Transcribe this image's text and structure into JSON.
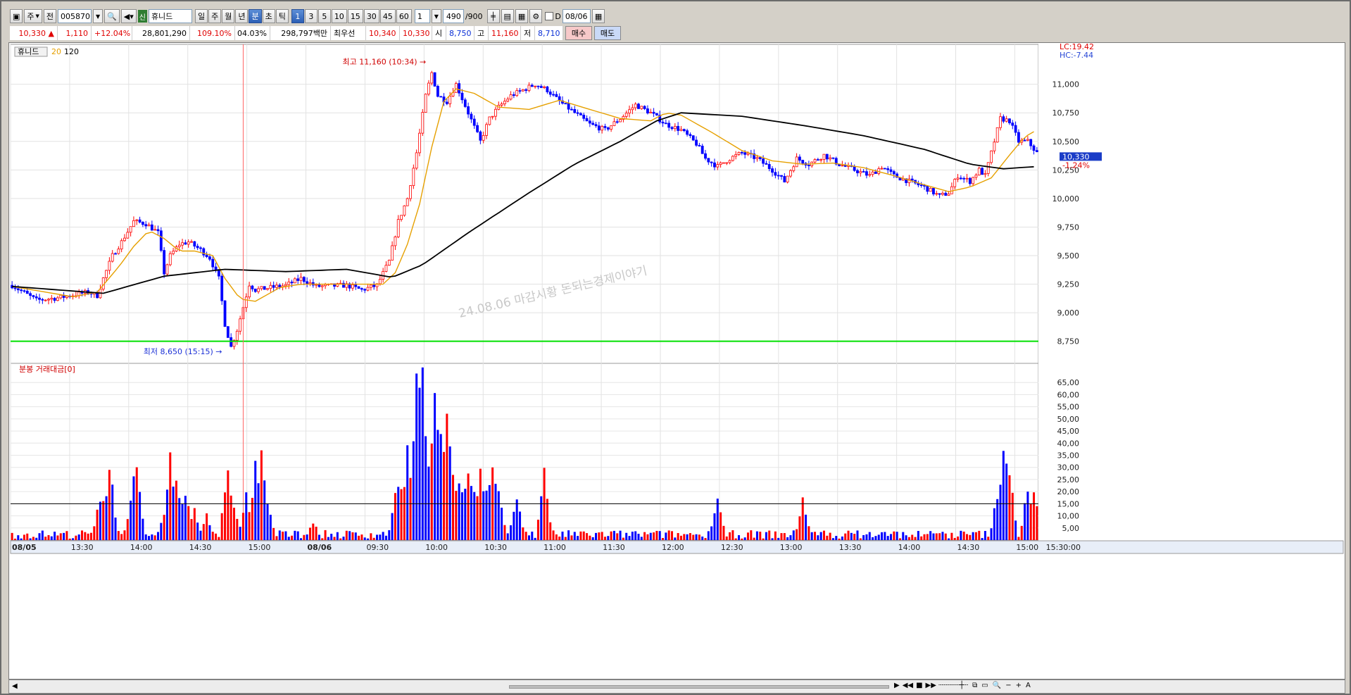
{
  "toolbar": {
    "market_label": "주",
    "period_label": "전",
    "code": "005870",
    "badge": "신",
    "name": "휴니드",
    "periods": [
      "일",
      "주",
      "월",
      "년",
      "분",
      "초",
      "틱"
    ],
    "active_period": "분",
    "intervals": [
      "1",
      "3",
      "5",
      "10",
      "15",
      "30",
      "45",
      "60"
    ],
    "active_interval": "1",
    "custom_interval": "1",
    "count": "490",
    "count_max": "/900",
    "d_label": "D",
    "date": "08/06"
  },
  "quote": {
    "price": "10,330",
    "change": "1,110",
    "change_pct": "+12.04%",
    "volume": "28,801,290",
    "vol_ratio": "109.10%",
    "turnover": "04.03%",
    "amount": "298,797백만",
    "label_recent": "최우선",
    "ask": "10,340",
    "bid": "10,330",
    "open_label": "시",
    "open": "8,750",
    "high_label": "고",
    "high": "11,160",
    "low_label": "저",
    "low": "8,710",
    "buy": "매수",
    "sell": "매도"
  },
  "colors": {
    "up": "#ff0000",
    "down": "#0000ff",
    "ma20": "#e6a000",
    "ma120": "#000000",
    "support": "#00e000",
    "cursor": "#ff6666"
  },
  "chart_data": [
    {
      "type": "candlestick",
      "title": "휴니드",
      "legend": [
        "20",
        "120"
      ],
      "ylim": [
        8600,
        11300
      ],
      "yticks": [
        "11,000",
        "10,750",
        "10,500",
        "10,250",
        "10,000",
        "9,750",
        "9,500",
        "9,250",
        "9,000",
        "8,750"
      ],
      "ytick_values": [
        11000,
        10750,
        10500,
        10250,
        10000,
        9750,
        9500,
        9250,
        9000,
        8750
      ],
      "x_labels": [
        "08/05",
        "13:30",
        "14:00",
        "14:30",
        "15:00",
        "08/06",
        "09:30",
        "10:00",
        "10:30",
        "11:00",
        "11:30",
        "12:00",
        "12:30",
        "13:00",
        "13:30",
        "14:00",
        "14:30",
        "15:00",
        "15:30:00"
      ],
      "lc_label": "LC:19.42",
      "hc_label": "HC:-7.44",
      "last_price": "10,330",
      "last_change": "-1.24%",
      "high_note": "최고 11,160 (10:34)",
      "low_note": "최저 8,650 (15:15)",
      "support_level": 8750,
      "watermark": "24.08.06 마감시황   돈되는경제이야기",
      "price_path": [
        [
          0,
          9240
        ],
        [
          8,
          9110
        ],
        [
          15,
          9130
        ],
        [
          25,
          9180
        ],
        [
          28,
          9150
        ],
        [
          30,
          9300
        ],
        [
          33,
          9500
        ],
        [
          36,
          9620
        ],
        [
          40,
          9800
        ],
        [
          44,
          9780
        ],
        [
          48,
          9700
        ],
        [
          50,
          9350
        ],
        [
          52,
          9500
        ],
        [
          55,
          9600
        ],
        [
          58,
          9620
        ],
        [
          62,
          9550
        ],
        [
          65,
          9480
        ],
        [
          68,
          9300
        ],
        [
          70,
          8900
        ],
        [
          72,
          8700
        ],
        [
          74,
          8850
        ],
        [
          76,
          9050
        ],
        [
          78,
          9250
        ],
        [
          80,
          9200
        ],
        [
          85,
          9220
        ],
        [
          90,
          9240
        ],
        [
          95,
          9300
        ],
        [
          100,
          9230
        ],
        [
          110,
          9240
        ],
        [
          115,
          9200
        ],
        [
          120,
          9240
        ],
        [
          124,
          9450
        ],
        [
          127,
          9800
        ],
        [
          130,
          10000
        ],
        [
          133,
          10400
        ],
        [
          136,
          10900
        ],
        [
          138,
          11100
        ],
        [
          140,
          10900
        ],
        [
          143,
          10850
        ],
        [
          146,
          11000
        ],
        [
          150,
          10750
        ],
        [
          154,
          10500
        ],
        [
          157,
          10700
        ],
        [
          160,
          10800
        ],
        [
          164,
          10900
        ],
        [
          168,
          10950
        ],
        [
          172,
          11000
        ],
        [
          176,
          10950
        ],
        [
          180,
          10850
        ],
        [
          185,
          10750
        ],
        [
          190,
          10650
        ],
        [
          195,
          10600
        ],
        [
          200,
          10700
        ],
        [
          205,
          10820
        ],
        [
          210,
          10750
        ],
        [
          215,
          10650
        ],
        [
          220,
          10600
        ],
        [
          225,
          10480
        ],
        [
          228,
          10350
        ],
        [
          232,
          10280
        ],
        [
          236,
          10350
        ],
        [
          240,
          10400
        ],
        [
          245,
          10350
        ],
        [
          250,
          10250
        ],
        [
          254,
          10150
        ],
        [
          258,
          10350
        ],
        [
          262,
          10300
        ],
        [
          267,
          10380
        ],
        [
          272,
          10300
        ],
        [
          277,
          10250
        ],
        [
          282,
          10200
        ],
        [
          286,
          10280
        ],
        [
          290,
          10200
        ],
        [
          295,
          10150
        ],
        [
          300,
          10100
        ],
        [
          305,
          10020
        ],
        [
          308,
          10050
        ],
        [
          311,
          10200
        ],
        [
          315,
          10150
        ],
        [
          318,
          10250
        ],
        [
          320,
          10200
        ],
        [
          322,
          10400
        ],
        [
          325,
          10700
        ],
        [
          328,
          10680
        ],
        [
          331,
          10500
        ],
        [
          334,
          10500
        ],
        [
          337,
          10400
        ]
      ],
      "ma20_path": [
        [
          0,
          9230
        ],
        [
          20,
          9140
        ],
        [
          28,
          9180
        ],
        [
          35,
          9400
        ],
        [
          40,
          9580
        ],
        [
          45,
          9720
        ],
        [
          50,
          9650
        ],
        [
          55,
          9540
        ],
        [
          60,
          9540
        ],
        [
          66,
          9500
        ],
        [
          70,
          9300
        ],
        [
          75,
          9120
        ],
        [
          80,
          9100
        ],
        [
          88,
          9220
        ],
        [
          95,
          9250
        ],
        [
          105,
          9250
        ],
        [
          115,
          9250
        ],
        [
          122,
          9250
        ],
        [
          126,
          9350
        ],
        [
          130,
          9600
        ],
        [
          134,
          9950
        ],
        [
          138,
          10450
        ],
        [
          142,
          10850
        ],
        [
          146,
          10960
        ],
        [
          152,
          10920
        ],
        [
          160,
          10800
        ],
        [
          170,
          10780
        ],
        [
          180,
          10860
        ],
        [
          190,
          10780
        ],
        [
          200,
          10700
        ],
        [
          210,
          10680
        ],
        [
          215,
          10750
        ],
        [
          220,
          10730
        ],
        [
          230,
          10580
        ],
        [
          240,
          10420
        ],
        [
          250,
          10330
        ],
        [
          260,
          10300
        ],
        [
          270,
          10310
        ],
        [
          280,
          10270
        ],
        [
          290,
          10200
        ],
        [
          300,
          10120
        ],
        [
          308,
          10060
        ],
        [
          315,
          10100
        ],
        [
          322,
          10180
        ],
        [
          328,
          10380
        ],
        [
          333,
          10540
        ],
        [
          337,
          10600
        ]
      ],
      "ma120_path": [
        [
          0,
          9230
        ],
        [
          30,
          9170
        ],
        [
          50,
          9320
        ],
        [
          70,
          9380
        ],
        [
          90,
          9360
        ],
        [
          110,
          9380
        ],
        [
          125,
          9310
        ],
        [
          135,
          9420
        ],
        [
          150,
          9700
        ],
        [
          170,
          10050
        ],
        [
          185,
          10300
        ],
        [
          200,
          10500
        ],
        [
          212,
          10680
        ],
        [
          220,
          10750
        ],
        [
          240,
          10720
        ],
        [
          260,
          10640
        ],
        [
          280,
          10550
        ],
        [
          300,
          10430
        ],
        [
          315,
          10300
        ],
        [
          326,
          10260
        ],
        [
          337,
          10280
        ]
      ],
      "n_bars": 338
    },
    {
      "type": "bar",
      "title": "분봉 거래대금[0]",
      "ylim": [
        0,
        70
      ],
      "yticks": [
        "65,00",
        "60,00",
        "55,00",
        "50,00",
        "45,00",
        "40,00",
        "35,00",
        "30,00",
        "25,00",
        "20,00",
        "15,00",
        "10,00",
        "5,00"
      ],
      "ytick_values": [
        65,
        60,
        55,
        50,
        45,
        40,
        35,
        30,
        25,
        20,
        15,
        10,
        5
      ],
      "reference_line": 15,
      "peaks": [
        [
          29,
          18
        ],
        [
          30,
          15
        ],
        [
          32,
          32
        ],
        [
          40,
          27
        ],
        [
          41,
          28
        ],
        [
          50,
          10
        ],
        [
          52,
          33
        ],
        [
          54,
          25
        ],
        [
          57,
          20
        ],
        [
          60,
          12
        ],
        [
          64,
          10
        ],
        [
          71,
          33
        ],
        [
          73,
          15
        ],
        [
          77,
          18
        ],
        [
          80,
          30
        ],
        [
          82,
          34
        ],
        [
          84,
          16
        ],
        [
          99,
          8
        ],
        [
          126,
          15
        ],
        [
          130,
          35
        ],
        [
          132,
          42
        ],
        [
          133,
          60
        ],
        [
          134,
          55
        ],
        [
          135,
          67
        ],
        [
          136,
          40
        ],
        [
          138,
          45
        ],
        [
          139,
          62
        ],
        [
          141,
          48
        ],
        [
          143,
          55
        ],
        [
          145,
          25
        ],
        [
          148,
          21
        ],
        [
          150,
          30
        ],
        [
          154,
          30
        ],
        [
          158,
          30
        ],
        [
          160,
          18
        ],
        [
          166,
          18
        ],
        [
          175,
          27
        ],
        [
          232,
          17
        ],
        [
          260,
          17
        ],
        [
          324,
          18
        ],
        [
          326,
          41
        ],
        [
          327,
          37
        ],
        [
          328,
          28
        ],
        [
          334,
          22
        ],
        [
          336,
          21
        ],
        [
          337,
          12
        ]
      ]
    }
  ],
  "bottom": {
    "zoom_label": "A"
  }
}
